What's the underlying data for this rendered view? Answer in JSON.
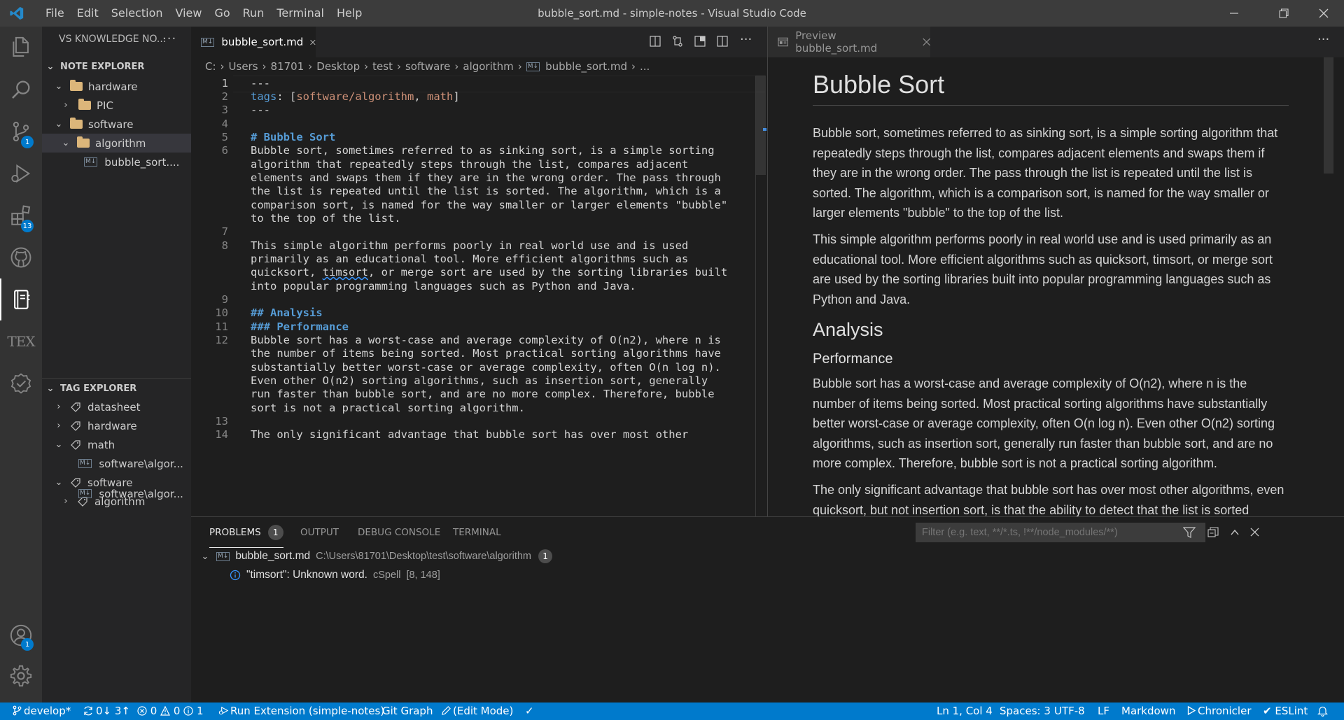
{
  "window": {
    "title": "bubble_sort.md - simple-notes - Visual Studio Code",
    "menu": [
      "File",
      "Edit",
      "Selection",
      "View",
      "Go",
      "Run",
      "Terminal",
      "Help"
    ]
  },
  "activity": {
    "badges": {
      "scm": "1",
      "extensions": "13",
      "accounts": "1"
    },
    "tex_label": "TEX"
  },
  "sidebar": {
    "title": "VS KNOWLEDGE NO...",
    "note_explorer": {
      "title": "NOTE EXPLORER",
      "items": [
        "hardware",
        "PIC",
        "software",
        "algorithm",
        "bubble_sort...."
      ]
    },
    "tag_explorer": {
      "title": "TAG EXPLORER",
      "items": [
        "datasheet",
        "hardware",
        "math",
        "software\\algor...",
        "software",
        "algorithm",
        "software\\algor..."
      ]
    },
    "md_icon": "M↓"
  },
  "editor": {
    "tab": "bubble_sort.md",
    "breadcrumb": [
      "C:",
      "Users",
      "81701",
      "Desktop",
      "test",
      "software",
      "algorithm",
      "bubble_sort.md",
      "..."
    ],
    "lines": {
      "n1": "1",
      "n2": "2",
      "n3": "3",
      "n4": "4",
      "n5": "5",
      "n6": "6",
      "n7": "7",
      "n8": "8",
      "n9": "9",
      "n10": "10",
      "n11": "11",
      "n12": "12",
      "n13": "13",
      "n14": "14",
      "l1": "---",
      "l2_key": "tags",
      "l2_rest": ": [",
      "l2_v1": "software/algorithm",
      "l2_sep": ", ",
      "l2_v2": "math",
      "l2_end": "]",
      "l3": "---",
      "l5": "# Bubble Sort",
      "l6a": "Bubble sort, sometimes referred to as sinking sort, is a simple sorting",
      "l6b": "algorithm that repeatedly steps through the list, compares adjacent",
      "l6c": "elements and swaps them if they are in the wrong order. The pass through",
      "l6d": "the list is repeated until the list is sorted. The algorithm, which is a",
      "l6e": "comparison sort, is named for the way smaller or larger elements \"bubble\"",
      "l6f": "to the top of the list.",
      "l8a": "This simple algorithm performs poorly in real world use and is used",
      "l8b": "primarily as an educational tool. More efficient algorithms such as",
      "l8c_pre": "quicksort, ",
      "l8c_word": "timsort",
      "l8c_post": ", or merge sort are used by the sorting libraries built",
      "l8d": "into popular programming languages such as Python and Java.",
      "l10": "## Analysis",
      "l11": "### Performance",
      "l12a": "Bubble sort has a worst-case and average complexity of O(n2), where n is",
      "l12b": "the number of items being sorted. Most practical sorting algorithms have",
      "l12c": "substantially better worst-case or average complexity, often O(n log n).",
      "l12d": "Even other O(n2) sorting algorithms, such as insertion sort, generally",
      "l12e": "run faster than bubble sort, and are no more complex. Therefore, bubble",
      "l12f": "sort is not a practical sorting algorithm.",
      "l14": "The only significant advantage that bubble sort has over most other"
    }
  },
  "preview": {
    "tab": "Preview bubble_sort.md",
    "h1": "Bubble Sort",
    "p1": "Bubble sort, sometimes referred to as sinking sort, is a simple sorting algorithm that repeatedly steps through the list, compares adjacent elements and swaps them if they are in the wrong order. The pass through the list is repeated until the list is sorted. The algorithm, which is a comparison sort, is named for the way smaller or larger elements \"bubble\" to the top of the list.",
    "p2": "This simple algorithm performs poorly in real world use and is used primarily as an educational tool. More efficient algorithms such as quicksort, timsort, or merge sort are used by the sorting libraries built into popular programming languages such as Python and Java.",
    "h2": "Analysis",
    "h3": "Performance",
    "p3": "Bubble sort has a worst-case and average complexity of O(n2), where n is the number of items being sorted. Most practical sorting algorithms have substantially better worst-case or average complexity, often O(n log n). Even other O(n2) sorting algorithms, such as insertion sort, generally run faster than bubble sort, and are no more complex. Therefore, bubble sort is not a practical sorting algorithm.",
    "p4": "The only significant advantage that bubble sort has over most other algorithms, even quicksort, but not insertion sort, is that the ability to detect that the list is sorted"
  },
  "panel": {
    "tabs": [
      "PROBLEMS",
      "OUTPUT",
      "DEBUG CONSOLE",
      "TERMINAL"
    ],
    "problems_count": "1",
    "filter_placeholder": "Filter (e.g. text, **/*.ts, !**/node_modules/**)",
    "file": "bubble_sort.md",
    "path": "C:\\Users\\81701\\Desktop\\test\\software\\algorithm",
    "file_count": "1",
    "message": "\"timsort\": Unknown word.",
    "source": "cSpell",
    "position": "[8, 148]"
  },
  "status": {
    "branch": "develop*",
    "sync": "0↓ 3↑",
    "errors": "0",
    "warnings": "0",
    "infos": "1",
    "run_ext": "Run Extension (simple-notes)",
    "git_graph": "Git Graph",
    "edit_mode": "(Edit Mode)",
    "check": "✓",
    "position": "Ln 1, Col 4",
    "spaces": "Spaces: 3",
    "encoding": "UTF-8",
    "eol": "LF",
    "language": "Markdown",
    "chronicler": "Chronicler",
    "eslint": "ESLint"
  },
  "colors": {
    "accent": "#007acc",
    "statusbar": "#007acc",
    "titlebar": "#3c3c3c",
    "editor_bg": "#1e1e1e"
  }
}
